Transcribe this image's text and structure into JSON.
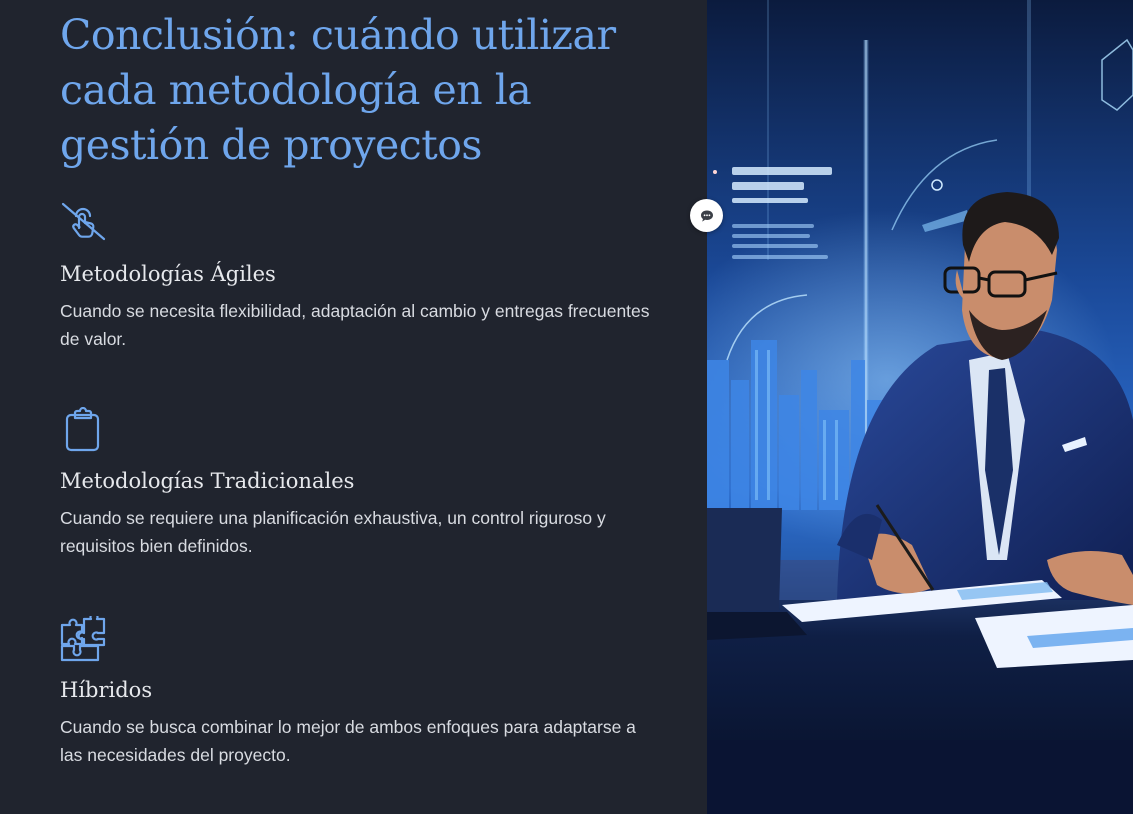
{
  "slide": {
    "title": "Conclusión: cuándo utilizar cada metodología en la gestión de proyectos",
    "items": [
      {
        "icon": "hand-tap-slash-icon",
        "heading": "Metodologías Ágiles",
        "text": "Cuando se necesita flexibilidad, adaptación al cambio y entregas frecuentes de valor."
      },
      {
        "icon": "clipboard-icon",
        "heading": "Metodologías Tradicionales",
        "text": "Cuando se requiere una planificación exhaustiva, un control riguroso y requisitos bien definidos."
      },
      {
        "icon": "puzzle-pieces-icon",
        "heading": "Híbridos",
        "text": "Cuando se busca combinar lo mejor de ambos enfoques para adaptarse a las necesidades del proyecto."
      }
    ]
  },
  "image": {
    "subject": "businessman-writing-at-desk-illustration"
  },
  "comment_button": {
    "icon": "comment-icon"
  },
  "colors": {
    "background": "#20242e",
    "title": "#6fa6ec",
    "icon": "#6fa6ec",
    "heading": "#e6e8ec",
    "body_text": "#d8dbe1"
  }
}
